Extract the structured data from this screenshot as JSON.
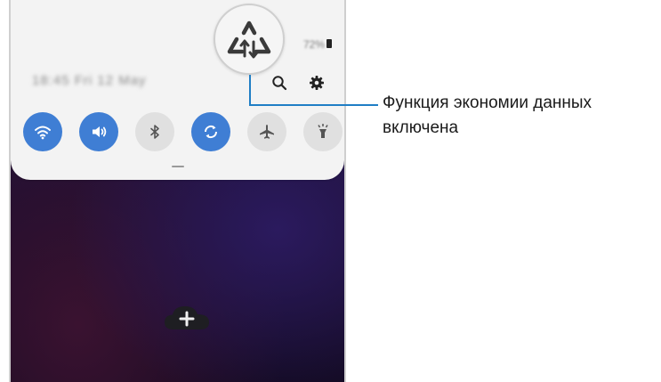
{
  "panel": {
    "status_text": "72%",
    "datetime_text": "18:45  Fri 12 May"
  },
  "quick_settings": [
    {
      "name": "wifi",
      "state": "on"
    },
    {
      "name": "sound",
      "state": "on"
    },
    {
      "name": "bluetooth",
      "state": "off"
    },
    {
      "name": "auto-rotate",
      "state": "on"
    },
    {
      "name": "airplane-mode",
      "state": "off"
    },
    {
      "name": "flashlight",
      "state": "off"
    }
  ],
  "callout": {
    "text": "Функция экономии данных включена"
  },
  "colors": {
    "accent": "#3f7ed4",
    "callout_line": "#1f7ec5",
    "panel_bg": "#f3f3f3"
  },
  "icons": [
    "data-saver-icon",
    "search-icon",
    "gear-icon",
    "wifi-icon",
    "sound-icon",
    "bluetooth-icon",
    "auto-rotate-icon",
    "airplane-icon",
    "flashlight-icon",
    "add-cloud-icon",
    "battery-icon"
  ]
}
